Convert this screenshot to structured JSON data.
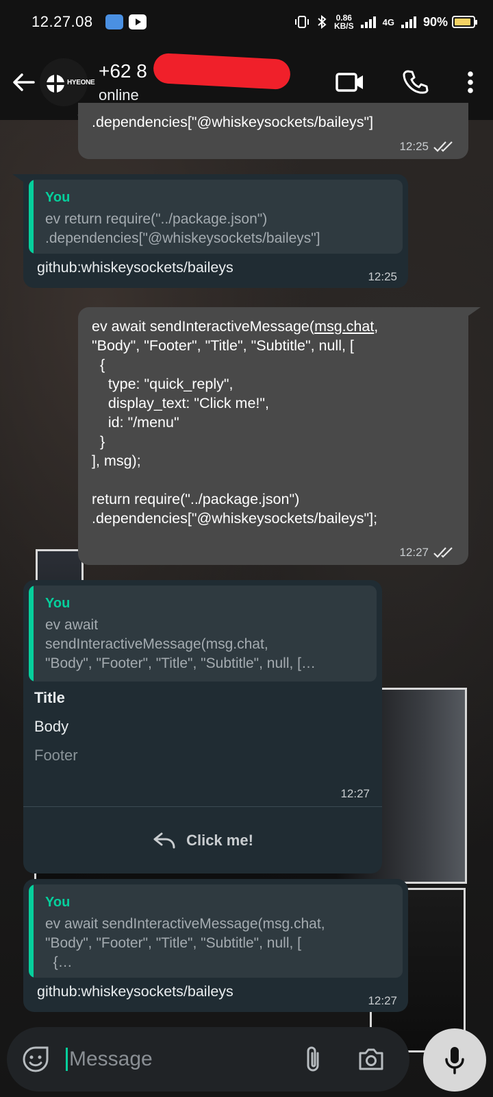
{
  "status_bar": {
    "time": "12.27.08",
    "net_speed_value": "0.86",
    "net_speed_unit": "KB/S",
    "network_type": "4G",
    "battery": "90%"
  },
  "header": {
    "avatar_text": "HYEONE",
    "contact_name": "+62 8",
    "status": "online"
  },
  "messages": [
    {
      "direction": "outgoing",
      "text": ".dependencies[\"@whiskeysockets/baileys\"]",
      "time": "12:25"
    },
    {
      "direction": "incoming",
      "quote_author": "You",
      "quote_text": "ev return require(\"../package.json\")\n.dependencies[\"@whiskeysockets/baileys\"]",
      "text": "github:whiskeysockets/baileys",
      "time": "12:25"
    },
    {
      "direction": "outgoing",
      "text_before_link": "ev await sendInteractiveMessage(",
      "link": "msg.chat",
      "text_after_link": ",",
      "body": "\"Body\", \"Footer\", \"Title\", \"Subtitle\", null, [\n  {\n    type: \"quick_reply\",\n    display_text: \"Click me!\",\n    id: \"/menu\"\n  }\n], msg);\n\nreturn require(\"../package.json\")\n.dependencies[\"@whiskeysockets/baileys\"];",
      "time": "12:27"
    },
    {
      "direction": "incoming",
      "quote_author": "You",
      "quote_text": "ev await\nsendInteractiveMessage(msg.chat,\n\"Body\", \"Footer\", \"Title\", \"Subtitle\", null, […",
      "title": "Title",
      "body": "Body",
      "footer": "Footer",
      "time": "12:27",
      "button_label": "Click me!"
    },
    {
      "direction": "incoming",
      "quote_author": "You",
      "quote_text": "ev await sendInteractiveMessage(msg.chat,\n\"Body\", \"Footer\", \"Title\", \"Subtitle\", null, [\n  {…",
      "text": "github:whiskeysockets/baileys",
      "time": "12:27"
    }
  ],
  "composer": {
    "placeholder": "Message"
  },
  "colors": {
    "accent": "#06cf9c",
    "outgoing_bubble": "#494949",
    "incoming_bubble": "#202c33",
    "header": "#121212"
  },
  "icons": [
    "back-arrow-icon",
    "video-call-icon",
    "voice-call-icon",
    "more-options-icon",
    "read-receipt-icon",
    "reply-icon",
    "sticker-icon",
    "attach-icon",
    "camera-icon",
    "mic-icon",
    "disappearing-timer-icon"
  ]
}
